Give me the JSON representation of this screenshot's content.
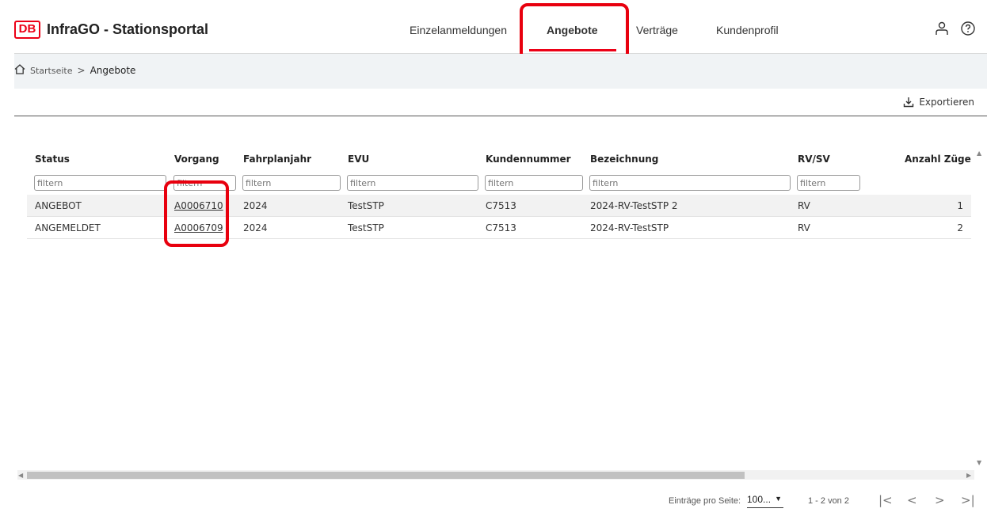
{
  "header": {
    "logo_text": "DB",
    "app_title": "InfraGO - Stationsportal",
    "nav": [
      "Einzelanmeldungen",
      "Angebote",
      "Verträge",
      "Kundenprofil"
    ],
    "active_nav": "Angebote",
    "icons": [
      "user-icon",
      "help-icon"
    ]
  },
  "breadcrumb": {
    "home": "Startseite",
    "separator": ">",
    "current": "Angebote"
  },
  "toolbar": {
    "export_label": "Exportieren"
  },
  "table": {
    "columns": [
      "Status",
      "Vorgang",
      "Fahrplanjahr",
      "EVU",
      "Kundennummer",
      "Bezeichnung",
      "RV/SV",
      "Anzahl Züge"
    ],
    "filter_placeholder": "filtern",
    "rows": [
      {
        "status": "ANGEBOT",
        "vorgang": "A0006710",
        "fahrplanjahr": "2024",
        "evu": "TestSTP",
        "kundennummer": "C7513",
        "bezeichnung": "2024-RV-TestSTP 2",
        "rvsv": "RV",
        "anzahl": "1"
      },
      {
        "status": "ANGEMELDET",
        "vorgang": "A0006709",
        "fahrplanjahr": "2024",
        "evu": "TestSTP",
        "kundennummer": "C7513",
        "bezeichnung": "2024-RV-TestSTP",
        "rvsv": "RV",
        "anzahl": "2"
      }
    ]
  },
  "footer": {
    "per_page_label": "Einträge pro Seite:",
    "per_page_value": "100...",
    "range": "1 - 2 von 2",
    "pager": [
      "|<",
      "<",
      ">",
      ">|"
    ]
  },
  "colors": {
    "brand_red": "#ec0016",
    "highlight": "#e8000e"
  }
}
